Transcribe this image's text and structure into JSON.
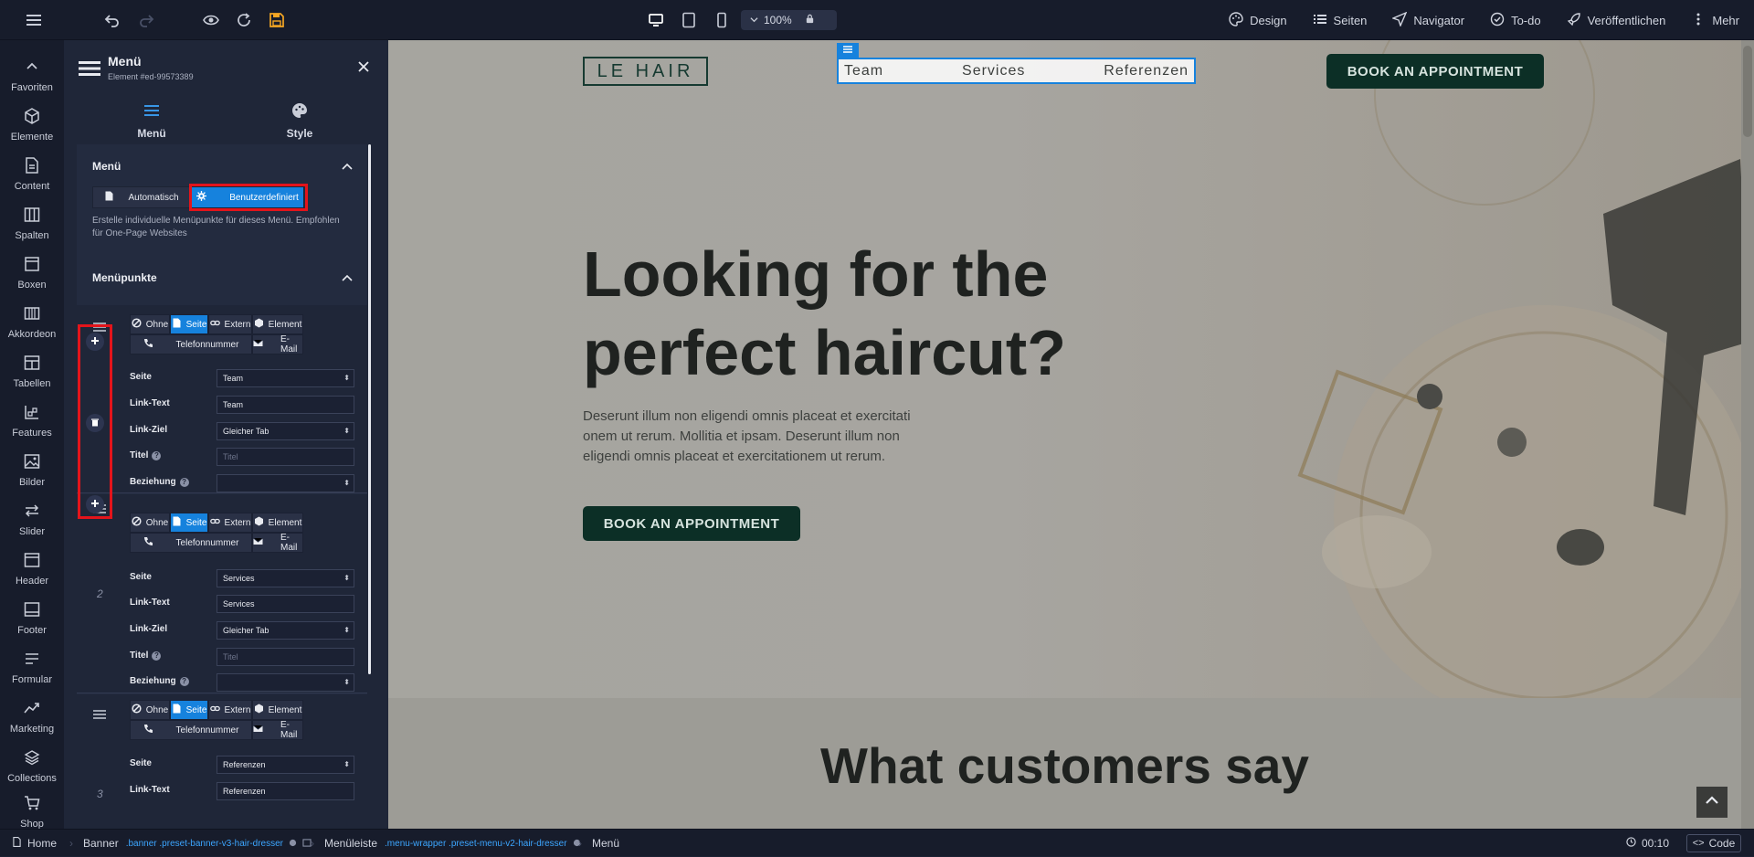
{
  "toolbar": {
    "zoom": "100%",
    "nav": [
      {
        "label": "Design",
        "icon": "palette-icon"
      },
      {
        "label": "Seiten",
        "icon": "list-icon"
      },
      {
        "label": "Navigator",
        "icon": "navigator-icon"
      },
      {
        "label": "To-do",
        "icon": "check-circle-icon"
      },
      {
        "label": "Veröffentlichen",
        "icon": "rocket-icon"
      },
      {
        "label": "Mehr",
        "icon": "more-icon"
      }
    ]
  },
  "sidebar": {
    "items": [
      {
        "label": "Favoriten",
        "icon": "chevron-up-icon"
      },
      {
        "label": "Elemente",
        "icon": "cube-icon"
      },
      {
        "label": "Content",
        "icon": "document-icon"
      },
      {
        "label": "Spalten",
        "icon": "columns-icon"
      },
      {
        "label": "Boxen",
        "icon": "box-icon"
      },
      {
        "label": "Akkordeon",
        "icon": "accordion-icon"
      },
      {
        "label": "Tabellen",
        "icon": "table-icon"
      },
      {
        "label": "Features",
        "icon": "features-icon"
      },
      {
        "label": "Bilder",
        "icon": "image-icon"
      },
      {
        "label": "Slider",
        "icon": "slider-icon"
      },
      {
        "label": "Header",
        "icon": "header-icon"
      },
      {
        "label": "Footer",
        "icon": "footer-icon"
      },
      {
        "label": "Formular",
        "icon": "form-icon"
      },
      {
        "label": "Marketing",
        "icon": "trend-icon"
      },
      {
        "label": "Collections",
        "icon": "layers-icon"
      },
      {
        "label": "Shop",
        "icon": "cart-icon"
      }
    ]
  },
  "panel": {
    "title": "Menü",
    "subtitle": "Element #ed-99573389",
    "tabs": [
      {
        "label": "Menü"
      },
      {
        "label": "Style"
      }
    ],
    "menu_section": {
      "heading": "Menü",
      "modes": [
        "Automatisch",
        "Benutzerdefiniert"
      ],
      "hint": "Erstelle individuelle Menüpunkte für dieses Menü. Empfohlen für One-Page Websites"
    },
    "items_section": {
      "heading": "Menüpunkte",
      "types": [
        "Ohne",
        "Seite",
        "Extern",
        "Element",
        "Telefonnummer",
        "E-Mail"
      ],
      "labels": {
        "seite": "Seite",
        "linktext": "Link-Text",
        "linkziel": "Link-Ziel",
        "titel": "Titel",
        "beziehung": "Beziehung"
      },
      "title_placeholder": "Titel",
      "items": [
        {
          "num": "",
          "seite": "Team",
          "linktext": "Team",
          "linkziel": "Gleicher Tab"
        },
        {
          "num": "2",
          "seite": "Services",
          "linktext": "Services",
          "linkziel": "Gleicher Tab"
        },
        {
          "num": "3",
          "seite": "Referenzen",
          "linktext": "Referenzen",
          "linkziel": ""
        }
      ]
    }
  },
  "site": {
    "logo": "LE HAIR",
    "menu": [
      "Team",
      "Services",
      "Referenzen"
    ],
    "cta": "BOOK AN APPOINTMENT",
    "hero_title_1": "Looking for the",
    "hero_title_2": "perfect haircut?",
    "hero_text_1": "Deserunt illum non eligendi omnis placeat et exercitati",
    "hero_text_2": "onem ut rerum. Mollitia et ipsam. Deserunt illum non",
    "hero_text_3": "eligendi omnis placeat et exercitationem ut rerum.",
    "hero_button": "BOOK AN APPOINTMENT",
    "section2_title": "What customers say"
  },
  "breadcrumb": {
    "items": [
      {
        "label": "Home",
        "class": ""
      },
      {
        "label": "Banner",
        "class": ".banner .preset-banner-v3-hair-dresser"
      },
      {
        "label": "Menüleiste",
        "class": ".menu-wrapper .preset-menu-v2-hair-dresser"
      },
      {
        "label": "Menü",
        "class": ""
      }
    ],
    "timer": "00:10",
    "code": "Code"
  },
  "colors": {
    "accent": "#1682dd",
    "highlight": "#e3141b",
    "cta": "#0c2f26",
    "ink": "#1f2220"
  }
}
